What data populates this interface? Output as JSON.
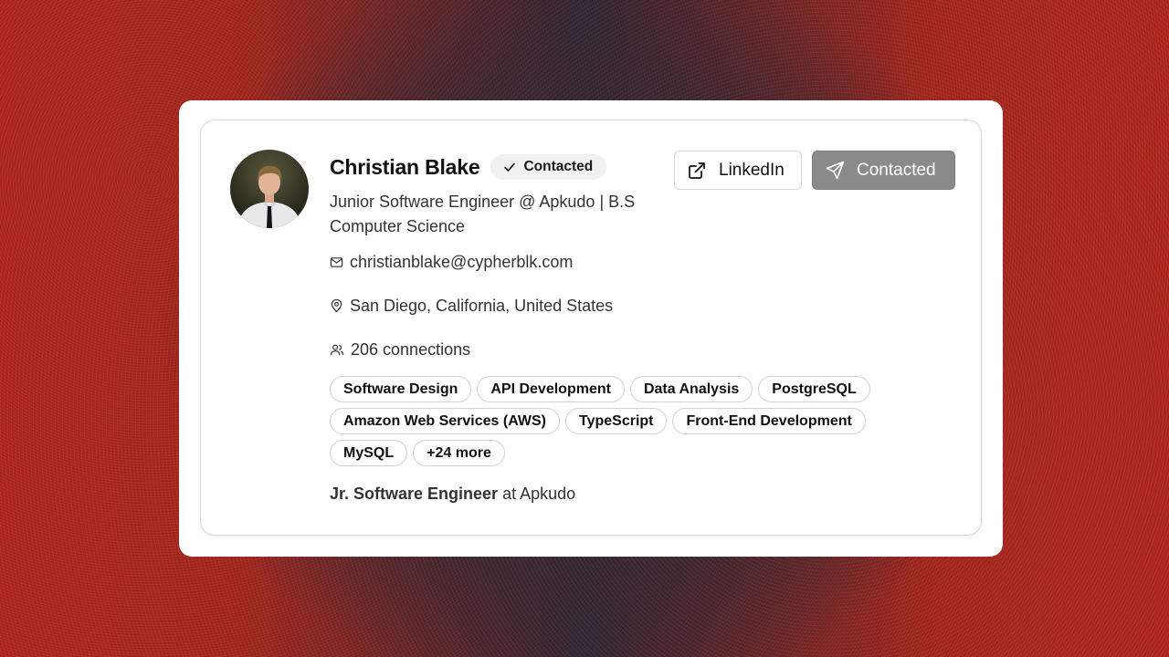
{
  "profile": {
    "name": "Christian Blake",
    "status_badge": "Contacted",
    "headline": "Junior Software Engineer @ Apkudo | B.S Computer Science",
    "email": "christianblake@cypherblk.com",
    "location": "San Diego, California, United States",
    "connections": "206 connections"
  },
  "actions": {
    "linkedin_label": "LinkedIn",
    "contacted_label": "Contacted"
  },
  "skills": [
    "Software Design",
    "API Development",
    "Data Analysis",
    "PostgreSQL",
    "Amazon Web Services (AWS)",
    "TypeScript",
    "Front-End Development",
    "MySQL",
    "+24 more"
  ],
  "current_role": {
    "title": "Jr. Software Engineer",
    "at_text": " at Apkudo"
  },
  "icons": {
    "check": "check-icon",
    "external_link": "external-link-icon",
    "send": "send-icon",
    "mail": "mail-icon",
    "location": "map-pin-icon",
    "users": "users-icon"
  },
  "colors": {
    "background_red": "#b3281f",
    "background_dark": "#2d2a38",
    "contacted_button": "#8a8a8a"
  }
}
